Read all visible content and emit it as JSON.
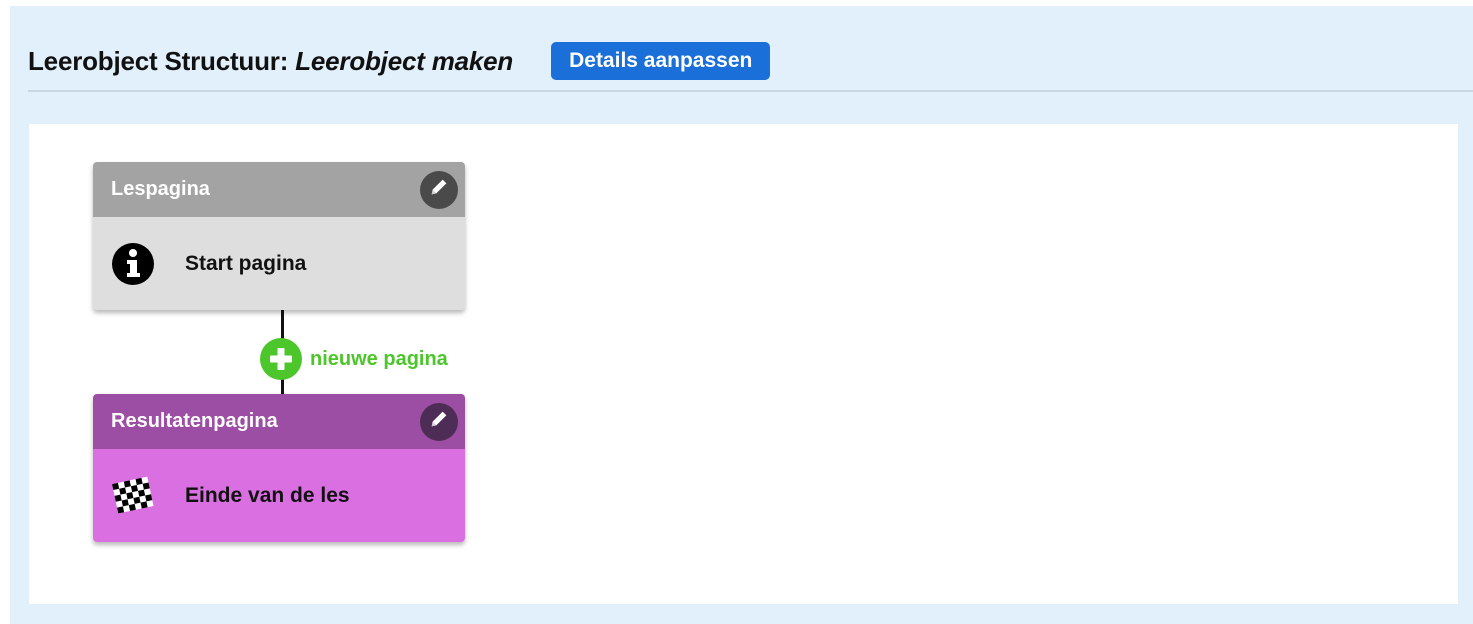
{
  "header": {
    "title_prefix": "Leerobject Structuur: ",
    "title_name": "Leerobject maken",
    "details_button": "Details aanpassen"
  },
  "pages": [
    {
      "type_label": "Lespagina",
      "title": "Start pagina",
      "icon": "info-icon",
      "head_color": "#a3a3a3",
      "body_color": "#dedede"
    },
    {
      "type_label": "Resultatenpagina",
      "title": "Einde van de les",
      "icon": "checkered-flag-icon",
      "head_color": "#9b4ea3",
      "body_color": "#d96fe1"
    }
  ],
  "add_page": {
    "label": "nieuwe pagina",
    "icon": "plus-circle-icon",
    "color": "#4cc62a"
  },
  "colors": {
    "accent": "#1b6fd8",
    "frame_bg": "#e2f0fc"
  }
}
